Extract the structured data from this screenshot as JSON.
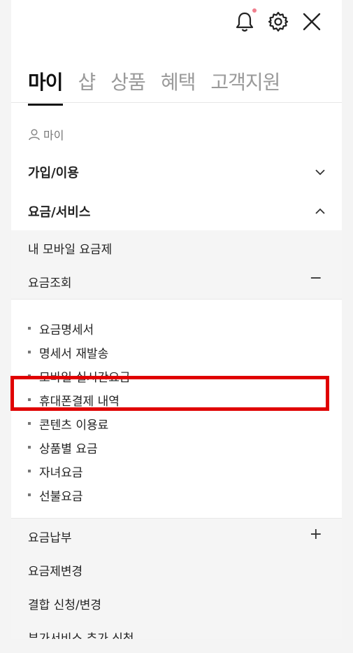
{
  "tabs": [
    "마이",
    "샵",
    "상품",
    "혜택",
    "고객지원"
  ],
  "section_label": "마이",
  "groups": {
    "join": "가입/이용",
    "billing": "요금/서비스"
  },
  "billing_sub": {
    "my_plan": "내 모바일 요금제",
    "inquiry": "요금조회",
    "inquiry_toggle": "−"
  },
  "inquiry_list": [
    "요금명세서",
    "명세서 재발송",
    "모바일 실시간요금",
    "휴대폰결제 내역",
    "콘텐츠 이용료",
    "상품별 요금",
    "자녀요금",
    "선불요금"
  ],
  "more_sub": {
    "payment": "요금납부",
    "payment_toggle": "+",
    "plan_change": "요금제변경",
    "bundle": "결합 신청/변경",
    "addon": "부가서비스 추가 신청"
  },
  "icons": {
    "bell": "bell-icon",
    "settings": "gear-icon",
    "close": "close-icon"
  },
  "colors": {
    "highlight": "#e00000",
    "notif_dot": "#f07f8e"
  }
}
